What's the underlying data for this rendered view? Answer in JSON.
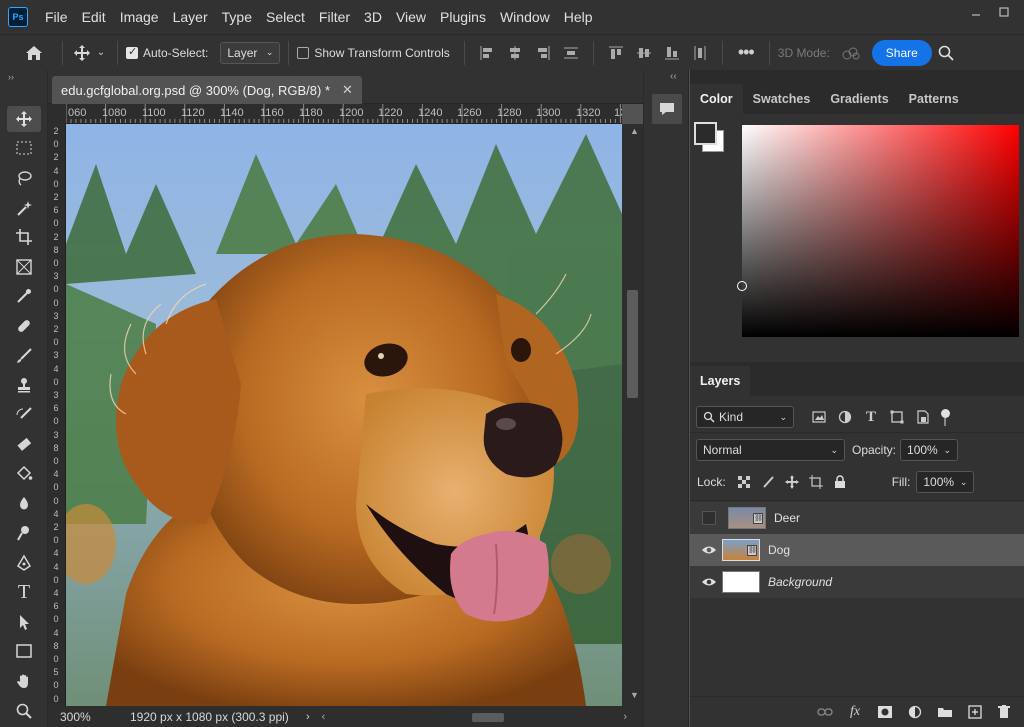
{
  "app": {
    "logo": "Ps"
  },
  "menu": [
    "File",
    "Edit",
    "Image",
    "Layer",
    "Type",
    "Select",
    "Filter",
    "3D",
    "View",
    "Plugins",
    "Window",
    "Help"
  ],
  "options": {
    "auto_select_label": "Auto-Select:",
    "auto_select_value": "Layer",
    "transform_label": "Show Transform Controls",
    "mode3d_label": "3D Mode:",
    "share_label": "Share"
  },
  "document": {
    "tab_title": "edu.gcfglobal.org.psd @ 300% (Dog, RGB/8) *",
    "ruler_top": [
      "060",
      "1080",
      "1100",
      "1120",
      "1140",
      "1160",
      "1180",
      "1200",
      "1220",
      "1240",
      "1260",
      "1280",
      "1300",
      "1320",
      "13"
    ],
    "ruler_left": [
      "2",
      "0",
      "2",
      "4",
      "0",
      "2",
      "6",
      "0",
      "2",
      "8",
      "0",
      "3",
      "0",
      "0",
      "3",
      "2",
      "0",
      "3",
      "4",
      "0",
      "3",
      "6",
      "0",
      "3",
      "8",
      "0",
      "4",
      "0",
      "0",
      "4",
      "2",
      "0",
      "4",
      "4",
      "0",
      "4",
      "6",
      "0",
      "4",
      "8",
      "0",
      "5",
      "0",
      "0"
    ],
    "zoom": "300%",
    "dimensions": "1920 px x 1080 px (300.3 ppi)"
  },
  "color_panel": {
    "tabs": [
      "Color",
      "Swatches",
      "Gradients",
      "Patterns"
    ],
    "hue": "#ff0000"
  },
  "layers_panel": {
    "title": "Layers",
    "filter_label": "Kind",
    "blend_mode": "Normal",
    "opacity_label": "Opacity:",
    "opacity_value": "100%",
    "lock_label": "Lock:",
    "fill_label": "Fill:",
    "fill_value": "100%",
    "layers": [
      {
        "name": "Deer",
        "visible": false,
        "selected": false
      },
      {
        "name": "Dog",
        "visible": true,
        "selected": true
      },
      {
        "name": "Background",
        "visible": true,
        "selected": false
      }
    ]
  },
  "colors": {
    "accent": "#1473e6",
    "panel": "#323232",
    "workspace": "#535353"
  }
}
